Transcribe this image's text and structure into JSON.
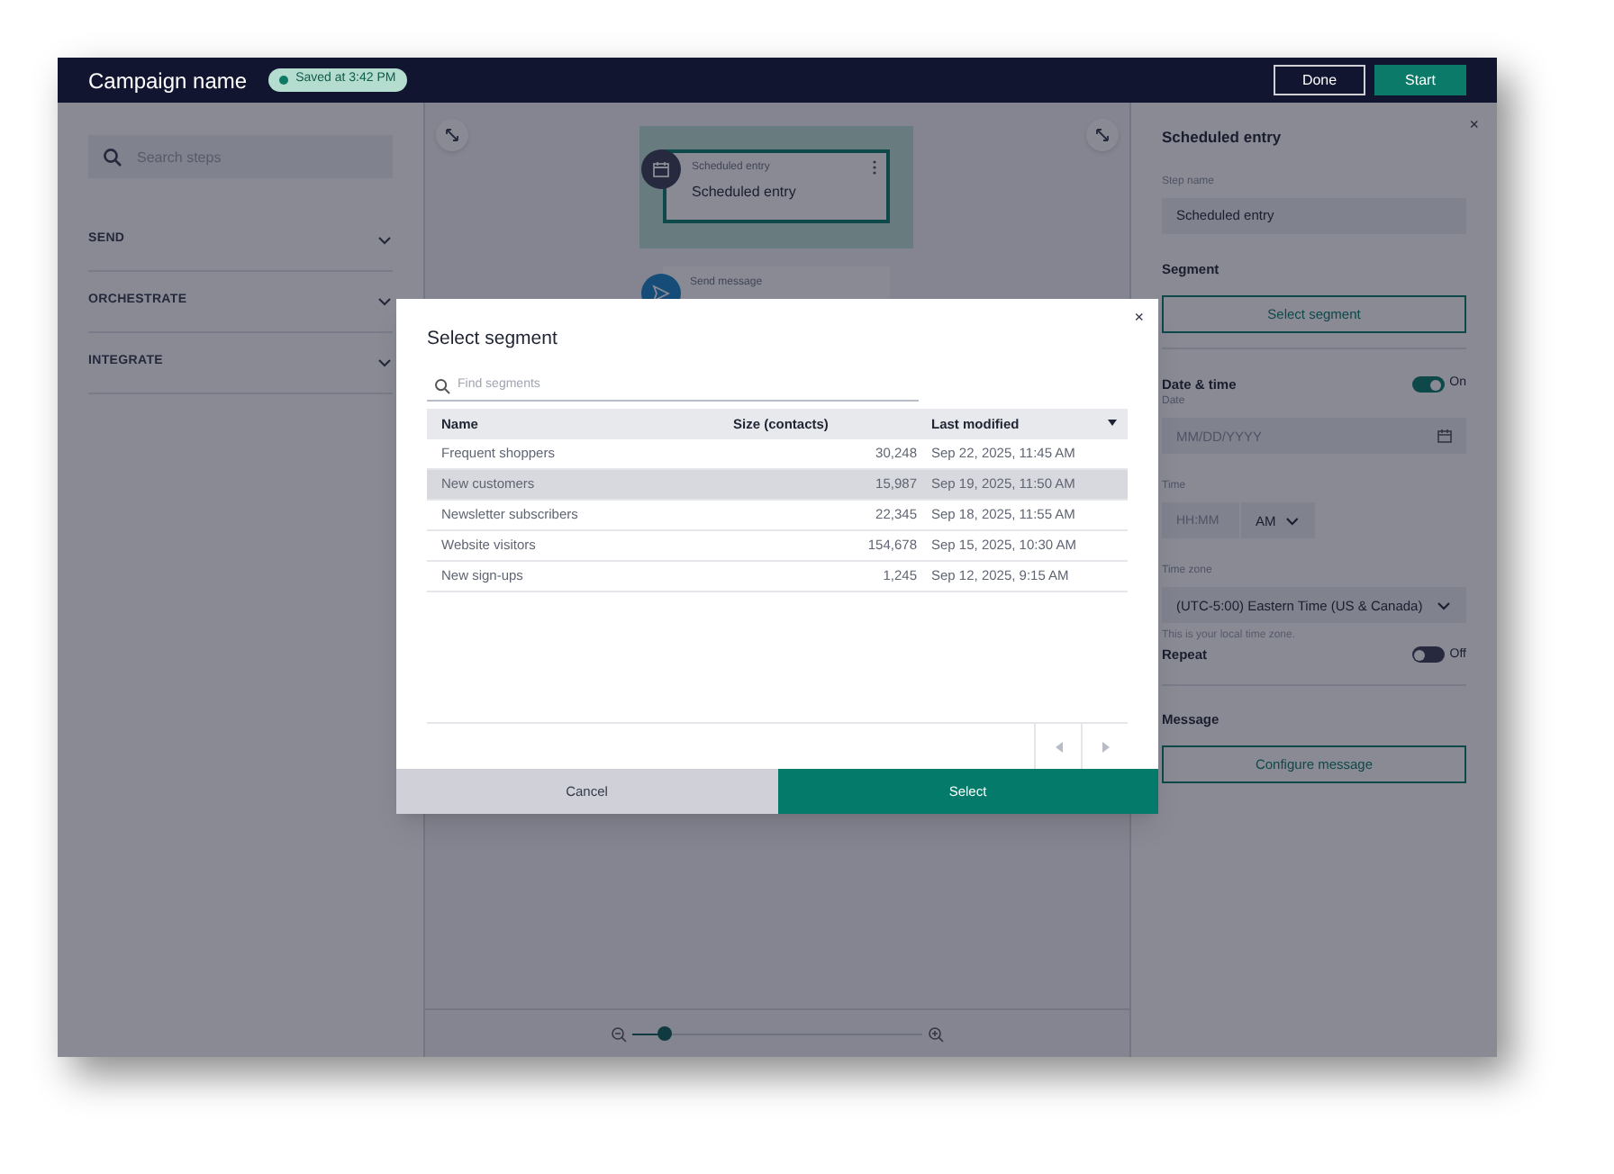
{
  "app_bar": {
    "title": "Campaign name",
    "status_badge": "Saved at 3:42 PM",
    "buttons": [
      {
        "label": "Done",
        "kind": "secondary"
      },
      {
        "label": "Start",
        "kind": "primary"
      }
    ]
  },
  "steps_panel": {
    "search": {
      "placeholder": "Search steps"
    },
    "sections": [
      {
        "label": "SEND",
        "expanded": false
      },
      {
        "label": "ORCHESTRATE",
        "expanded": false
      },
      {
        "label": "INTEGRATE",
        "expanded": false
      }
    ]
  },
  "canvas": {
    "nodes": [
      {
        "kind": "entry",
        "type_label": "Scheduled entry",
        "title": "Scheduled entry",
        "selected": true
      },
      {
        "kind": "message",
        "type_label": "Send message",
        "selected": false
      }
    ],
    "zoom": {
      "level": 0.11
    }
  },
  "settings_panel": {
    "title": "Scheduled entry",
    "close_icon": "×",
    "step_name": {
      "label": "Step name",
      "value": "Scheduled entry"
    },
    "segment": {
      "heading": "Segment",
      "button": "Select segment"
    },
    "date_time": {
      "heading": "Date & time",
      "on": true,
      "state_label": "On"
    },
    "date": {
      "label": "Date",
      "placeholder": "MM/DD/YYYY"
    },
    "time": {
      "label": "Time",
      "placeholder": "HH:MM",
      "period": "AM"
    },
    "time_zone": {
      "label": "Time zone",
      "value": "(UTC-5:00) Eastern Time (US & Canada)",
      "hint": "This is your local time zone."
    },
    "repeat": {
      "heading": "Repeat",
      "on": false,
      "state_label": "Off"
    },
    "message": {
      "heading": "Message",
      "button": "Configure message"
    }
  },
  "dialog": {
    "title": "Select segment",
    "close_icon": "×",
    "search": {
      "placeholder": "Find segments"
    },
    "columns": [
      {
        "label": "Name",
        "sorted": false
      },
      {
        "label": "Size (contacts)",
        "sorted": false
      },
      {
        "label": "Last modified",
        "sorted": true
      }
    ],
    "rows": [
      {
        "name": "Frequent shoppers",
        "size": "30,248",
        "modified": "Sep 22, 2025, 11:45 AM",
        "selected": false
      },
      {
        "name": "New customers",
        "size": "15,987",
        "modified": "Sep 19, 2025, 11:50 AM",
        "selected": true
      },
      {
        "name": "Newsletter subscribers",
        "size": "22,345",
        "modified": "Sep 18, 2025, 11:55 AM",
        "selected": false
      },
      {
        "name": "Website visitors",
        "size": "154,678",
        "modified": "Sep 15, 2025, 10:30 AM",
        "selected": false
      },
      {
        "name": "New sign-ups",
        "size": "1,245",
        "modified": "Sep 12, 2025, 9:15 AM",
        "selected": false
      }
    ],
    "buttons": [
      {
        "label": "Cancel",
        "kind": "secondary"
      },
      {
        "label": "Select",
        "kind": "primary"
      }
    ]
  }
}
